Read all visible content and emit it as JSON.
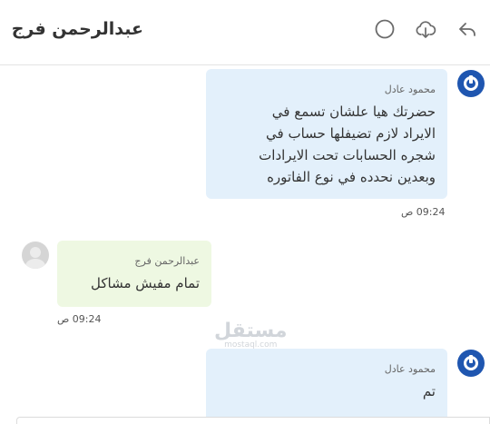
{
  "header": {
    "title": "عبدالرحمن فرج",
    "icons": [
      "reply-icon",
      "cloud-download-icon",
      "circle-status-icon"
    ]
  },
  "messages": [
    {
      "sender": "محمود عادل",
      "text_lines": [
        "حضرتك هيا علشان تسمع في",
        "الايراد لازم تضيفلها حساب في",
        "شجره الحسابات تحت الايرادات",
        "وبعدين نحدده في نوع الفاتوره"
      ],
      "time": "09:24 ص",
      "color": "#e3f0fb"
    },
    {
      "sender": "عبدالرحمن فرج",
      "text_lines": [
        "تمام مفيش مشاكل"
      ],
      "time": "09:24 ص",
      "color": "#eef8e2"
    },
    {
      "sender": "محمود عادل",
      "text_lines": [
        "تم"
      ],
      "time": "",
      "color": "#e3f0fb"
    }
  ],
  "watermark": {
    "ar": "مستقل",
    "en": "mostaql.com"
  },
  "colors": {
    "brand": "#1f56b0",
    "divider": "#e3e3e3"
  }
}
